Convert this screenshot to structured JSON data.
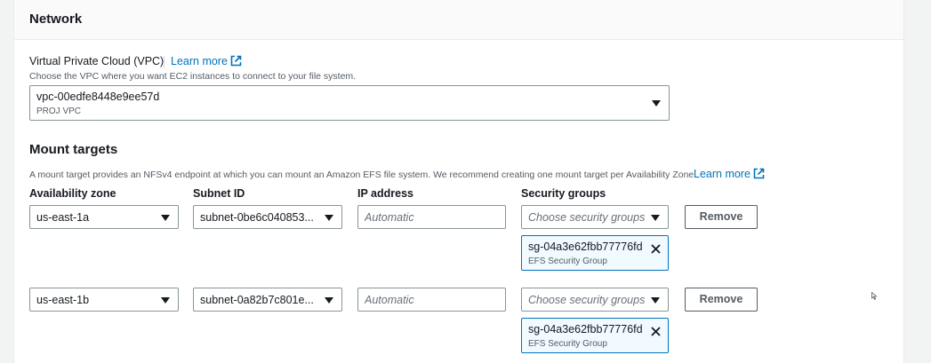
{
  "network": {
    "title": "Network",
    "vpc": {
      "label": "Virtual Private Cloud (VPC)",
      "learn_more": "Learn more",
      "description": "Choose the VPC where you want EC2 instances to connect to your file system.",
      "selected_id": "vpc-00edfe8448e9ee57d",
      "selected_name": "PROJ VPC"
    }
  },
  "mount_targets": {
    "title": "Mount targets",
    "description": "A mount target provides an NFSv4 endpoint at which you can mount an Amazon EFS file system. We recommend creating one mount target per Availability Zone.",
    "learn_more": "Learn more",
    "columns": {
      "availability_zone": "Availability zone",
      "subnet_id": "Subnet ID",
      "ip_address": "IP address",
      "security_groups": "Security groups"
    },
    "rows": [
      {
        "availability_zone": "us-east-1a",
        "subnet_id": "subnet-0be6c040853...",
        "ip_placeholder": "Automatic",
        "security_groups_placeholder": "Choose security groups",
        "remove_label": "Remove",
        "token": {
          "id": "sg-04a3e62fbb77776fd",
          "name": "EFS Security Group"
        }
      },
      {
        "availability_zone": "us-east-1b",
        "subnet_id": "subnet-0a82b7c801e...",
        "ip_placeholder": "Automatic",
        "security_groups_placeholder": "Choose security groups",
        "remove_label": "Remove",
        "token": {
          "id": "sg-04a3e62fbb77776fd",
          "name": "EFS Security Group"
        }
      }
    ]
  },
  "icons": {
    "external_link": "external-link-icon",
    "caret": "caret-down-icon",
    "dismiss": "close-icon"
  },
  "colors": {
    "link": "#0073bb",
    "token_border": "#0073bb",
    "token_bg": "#f1faff"
  }
}
